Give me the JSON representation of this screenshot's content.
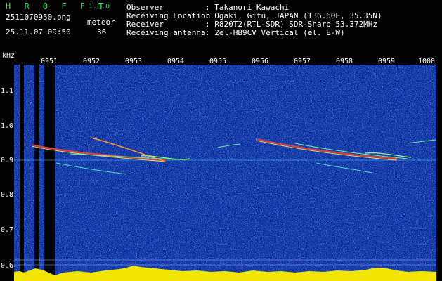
{
  "header": {
    "app_title": "H R O F F T",
    "version": "1.0.0",
    "filename": "2511070950.png",
    "meteor_label": "meteor",
    "datetime": "25.11.07 09:50",
    "meteor_count": "36"
  },
  "info": [
    {
      "label": "Observer",
      "value": ": Takanori Kawachi"
    },
    {
      "label": "Receiving Location",
      "value": ": Ogaki, Gifu, JAPAN (136.60E, 35.35N)"
    },
    {
      "label": "Receiver",
      "value": ": R820T2(RTL-SDR) SDR-Sharp 53.372MHz"
    },
    {
      "label": "Receiving antenna",
      "value": ": 2el-HB9CV Vertical (el. E-W)"
    }
  ],
  "axis": {
    "unit": "kHz",
    "y_ticks": [
      "1.1",
      "1.0",
      "0.9",
      "0.8",
      "0.7",
      "0.6"
    ],
    "x_ticks": [
      "0951",
      "0952",
      "0953",
      "0954",
      "0955",
      "0956",
      "0957",
      "0958",
      "0959",
      "1000"
    ]
  },
  "colors": {
    "background": "#000000",
    "noise_base": "#0b2a9a",
    "title_green": "#35e06a",
    "baseline_yellow": "#f2e600",
    "baseline_cyan": "#32c8ff"
  }
}
